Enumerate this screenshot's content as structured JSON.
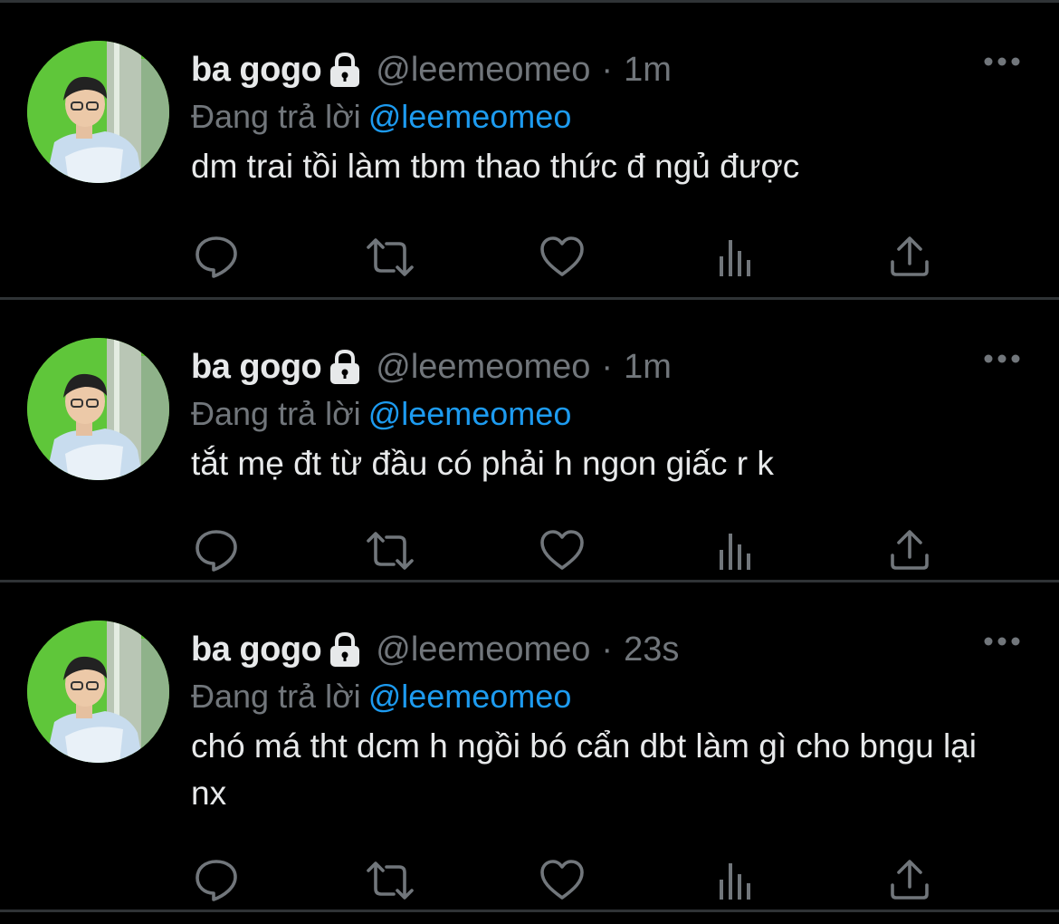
{
  "colors": {
    "background": "#000000",
    "divider": "#2f3336",
    "primary_text": "#e7e9ea",
    "secondary_text": "#71767b",
    "link": "#1d9bf0",
    "avatar_bg": "#5fc63a"
  },
  "tweets": [
    {
      "display_name": "ba gogo",
      "handle": "@leemeomeo",
      "separator": "·",
      "time": "1m",
      "reply_prefix": "Đang trả lời",
      "reply_to": "@leemeomeo",
      "text": "dm trai tồi làm tbm thao thức đ ngủ được",
      "icons": [
        "lock-icon",
        "more-icon",
        "reply-icon",
        "retweet-icon",
        "like-icon",
        "views-icon",
        "share-icon"
      ]
    },
    {
      "display_name": "ba gogo",
      "handle": "@leemeomeo",
      "separator": "·",
      "time": "1m",
      "reply_prefix": "Đang trả lời",
      "reply_to": "@leemeomeo",
      "text": "tắt mẹ đt từ đầu có phải h ngon giấc r k",
      "icons": [
        "lock-icon",
        "more-icon",
        "reply-icon",
        "retweet-icon",
        "like-icon",
        "views-icon",
        "share-icon"
      ]
    },
    {
      "display_name": "ba gogo",
      "handle": "@leemeomeo",
      "separator": "·",
      "time": "23s",
      "reply_prefix": "Đang trả lời",
      "reply_to": "@leemeomeo",
      "text": "chó má tht dcm h ngồi bó cẩn dbt làm gì cho bngu lại nx",
      "icons": [
        "lock-icon",
        "more-icon",
        "reply-icon",
        "retweet-icon",
        "like-icon",
        "views-icon",
        "share-icon"
      ]
    }
  ]
}
